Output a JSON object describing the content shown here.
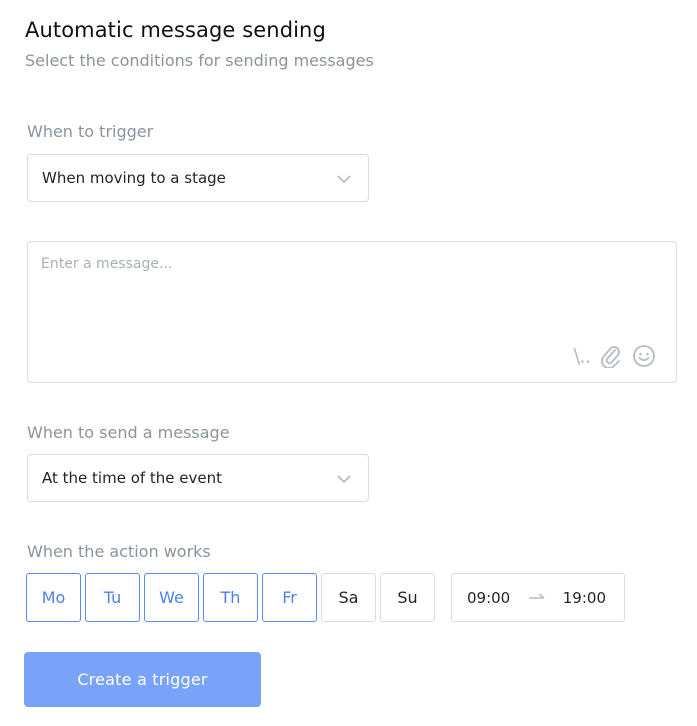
{
  "header": {
    "title": "Automatic message sending",
    "subtitle": "Select the conditions for sending messages"
  },
  "trigger": {
    "label": "When to trigger",
    "selected": "When moving to a stage"
  },
  "message": {
    "placeholder": "Enter a message...",
    "icons": [
      "template-icon",
      "attachment-icon",
      "emoji-icon"
    ],
    "template_glyph": "\\.."
  },
  "send": {
    "label": "When to send a message",
    "selected": "At the time of the event"
  },
  "schedule": {
    "label": "When the action works",
    "days": [
      {
        "label": "Mo",
        "active": true
      },
      {
        "label": "Tu",
        "active": true
      },
      {
        "label": "We",
        "active": true
      },
      {
        "label": "Th",
        "active": true
      },
      {
        "label": "Fr",
        "active": true
      },
      {
        "label": "Sa",
        "active": false
      },
      {
        "label": "Su",
        "active": false
      }
    ],
    "time_from": "09:00",
    "time_to": "19:00"
  },
  "actions": {
    "create_label": "Create a trigger"
  },
  "colors": {
    "accent": "#4e82ea",
    "button": "#79a3f8",
    "muted": "#8a939c",
    "border": "#d9dde2"
  }
}
